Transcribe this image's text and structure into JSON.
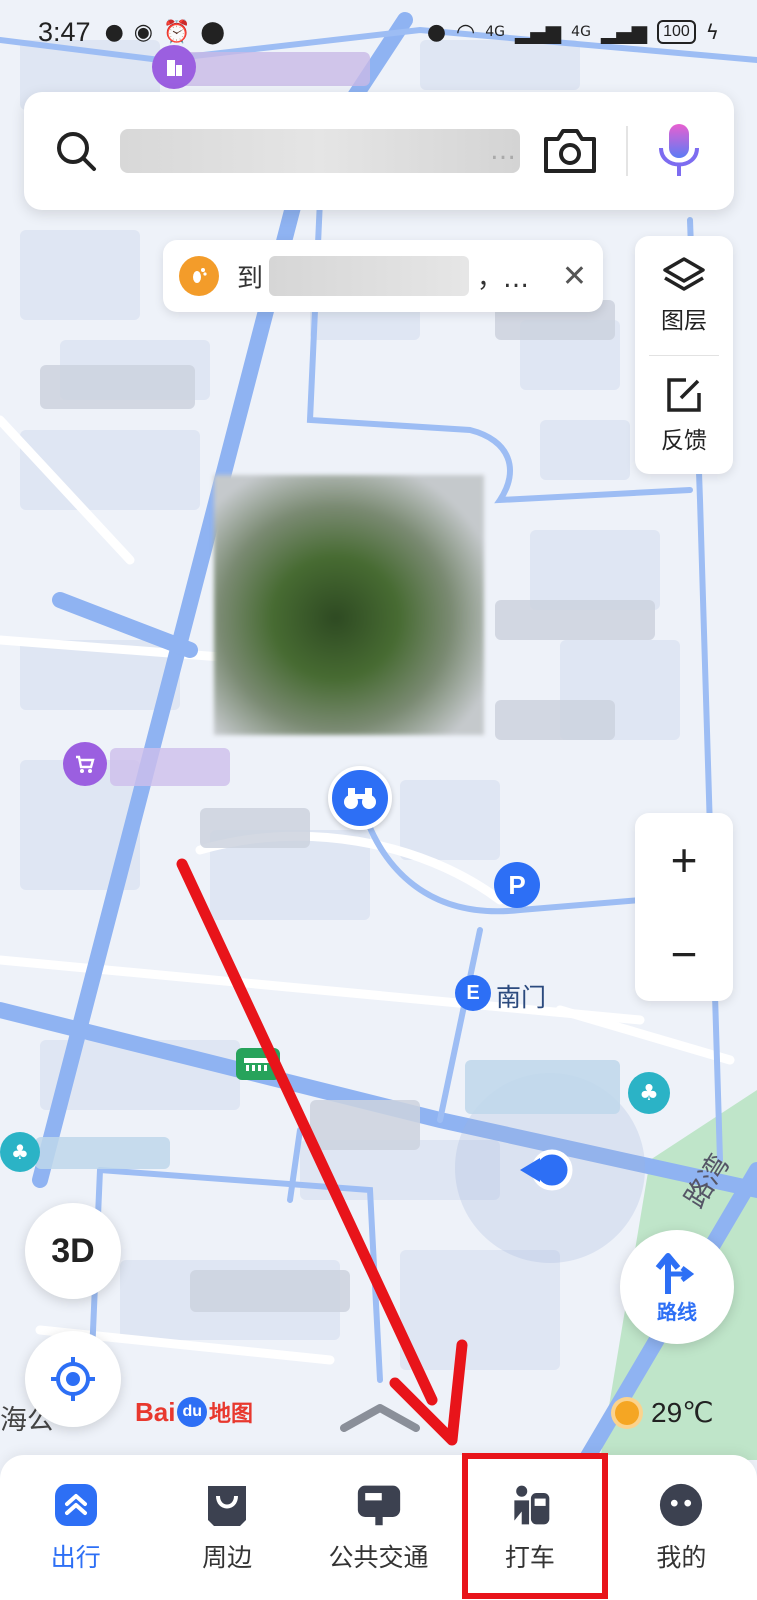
{
  "status_bar": {
    "time": "3:47",
    "signal_labels": [
      "4G",
      "4G"
    ],
    "battery": "100"
  },
  "search": {
    "placeholder": "…",
    "camera_icon": "camera-icon",
    "voice_icon": "microphone-icon"
  },
  "notice": {
    "prefix": "到",
    "suffix": "，…",
    "close": "✕"
  },
  "side_panel": {
    "layers_label": "图层",
    "feedback_label": "反馈"
  },
  "zoom": {
    "in": "+",
    "out": "−"
  },
  "map": {
    "labels": {
      "south_gate": "南门",
      "bottom_left": "海公"
    },
    "poi_icons": [
      "building-poi-icon",
      "shopping-cart-poi-icon",
      "binoculars-poi-icon",
      "parking-poi-icon",
      "exit-poi-icon",
      "park-poi-icon",
      "bus-stop-icon"
    ]
  },
  "controls": {
    "three_d": "3D",
    "route": "路线"
  },
  "brand": {
    "bai": "Bai",
    "du": "du",
    "ditu": "地图"
  },
  "weather": {
    "temp": "29℃"
  },
  "tabs": [
    {
      "label": "出行",
      "active": true
    },
    {
      "label": "周边",
      "active": false
    },
    {
      "label": "公共交通",
      "active": false
    },
    {
      "label": "打车",
      "active": false
    },
    {
      "label": "我的",
      "active": false
    }
  ],
  "colors": {
    "accent": "#2d6ff5",
    "highlight": "#e8141a",
    "road": "#8fb3f2"
  }
}
